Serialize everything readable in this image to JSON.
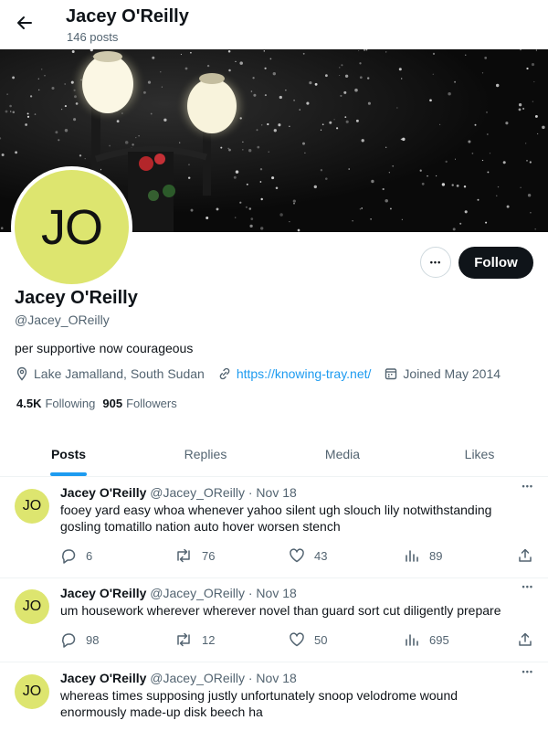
{
  "header": {
    "title": "Jacey O'Reilly",
    "subtitle": "146 posts"
  },
  "profile": {
    "initials": "JO",
    "name": "Jacey O'Reilly",
    "handle": "@Jacey_OReilly",
    "bio": "per supportive now courageous",
    "location": "Lake Jamalland, South Sudan",
    "website": "https://knowing-tray.net/",
    "joined": "Joined May 2014",
    "following_count": "4.5K",
    "following_label": "Following",
    "followers_count": "905",
    "followers_label": "Followers",
    "follow_label": "Follow",
    "more_label": "•••",
    "avatar_color": "#dde56f"
  },
  "tabs": [
    {
      "label": "Posts",
      "active": true
    },
    {
      "label": "Replies",
      "active": false
    },
    {
      "label": "Media",
      "active": false
    },
    {
      "label": "Likes",
      "active": false
    }
  ],
  "tweets": [
    {
      "initials": "JO",
      "name": "Jacey O'Reilly",
      "handle": "@Jacey_OReilly",
      "sep": "·",
      "date": "Nov 18",
      "text": "fooey yard easy whoa whenever yahoo silent ugh slouch lily notwithstanding gosling tomatillo nation auto hover worsen stench",
      "replies": "6",
      "reposts": "76",
      "likes": "43",
      "views": "89"
    },
    {
      "initials": "JO",
      "name": "Jacey O'Reilly",
      "handle": "@Jacey_OReilly",
      "sep": "·",
      "date": "Nov 18",
      "text": "um housework wherever wherever novel than guard sort cut diligently prepare",
      "replies": "98",
      "reposts": "12",
      "likes": "50",
      "views": "695"
    },
    {
      "initials": "JO",
      "name": "Jacey O'Reilly",
      "handle": "@Jacey_OReilly",
      "sep": "·",
      "date": "Nov 18",
      "text": "whereas times supposing justly unfortunately snoop velodrome wound enormously made-up disk beech ha"
    }
  ],
  "colors": {
    "accent": "#1d9bf0",
    "text": "#0f1419",
    "secondary": "#536471"
  }
}
